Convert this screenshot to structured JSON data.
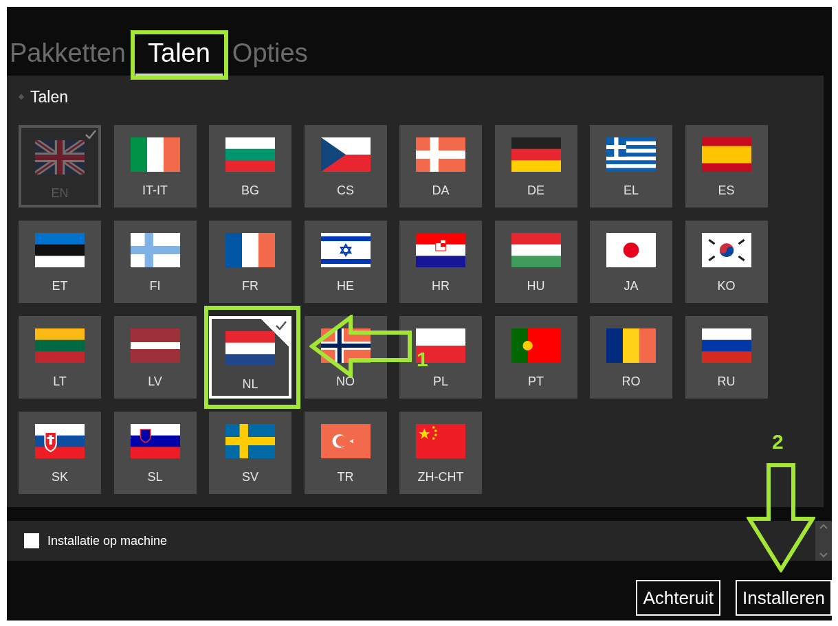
{
  "tabs": [
    {
      "label": "Pakketten",
      "selected": false
    },
    {
      "label": "Talen",
      "selected": true
    },
    {
      "label": "Opties",
      "selected": false
    }
  ],
  "section": {
    "title": "Talen",
    "expanded": true
  },
  "languages": [
    {
      "code": "EN",
      "checked": true,
      "disabled": true
    },
    {
      "code": "IT-IT",
      "checked": false,
      "disabled": false
    },
    {
      "code": "BG",
      "checked": false,
      "disabled": false
    },
    {
      "code": "CS",
      "checked": false,
      "disabled": false
    },
    {
      "code": "DA",
      "checked": false,
      "disabled": false
    },
    {
      "code": "DE",
      "checked": false,
      "disabled": false
    },
    {
      "code": "EL",
      "checked": false,
      "disabled": false
    },
    {
      "code": "ES",
      "checked": false,
      "disabled": false
    },
    {
      "code": "ET",
      "checked": false,
      "disabled": false
    },
    {
      "code": "FI",
      "checked": false,
      "disabled": false
    },
    {
      "code": "FR",
      "checked": false,
      "disabled": false
    },
    {
      "code": "HE",
      "checked": false,
      "disabled": false
    },
    {
      "code": "HR",
      "checked": false,
      "disabled": false
    },
    {
      "code": "HU",
      "checked": false,
      "disabled": false
    },
    {
      "code": "JA",
      "checked": false,
      "disabled": false
    },
    {
      "code": "KO",
      "checked": false,
      "disabled": false
    },
    {
      "code": "LT",
      "checked": false,
      "disabled": false
    },
    {
      "code": "LV",
      "checked": false,
      "disabled": false
    },
    {
      "code": "NL",
      "checked": true,
      "disabled": false
    },
    {
      "code": "NO",
      "checked": false,
      "disabled": false
    },
    {
      "code": "PL",
      "checked": false,
      "disabled": false
    },
    {
      "code": "PT",
      "checked": false,
      "disabled": false
    },
    {
      "code": "RO",
      "checked": false,
      "disabled": false
    },
    {
      "code": "RU",
      "checked": false,
      "disabled": false
    },
    {
      "code": "SK",
      "checked": false,
      "disabled": false
    },
    {
      "code": "SL",
      "checked": false,
      "disabled": false
    },
    {
      "code": "SV",
      "checked": false,
      "disabled": false
    },
    {
      "code": "TR",
      "checked": false,
      "disabled": false
    },
    {
      "code": "ZH-CHT",
      "checked": false,
      "disabled": false
    }
  ],
  "machine_install": {
    "label": "Installatie op machine",
    "checked": false
  },
  "buttons": [
    "Achteruit",
    "Installeren"
  ],
  "annotations": [
    {
      "label": "1"
    },
    {
      "label": "2"
    }
  ]
}
